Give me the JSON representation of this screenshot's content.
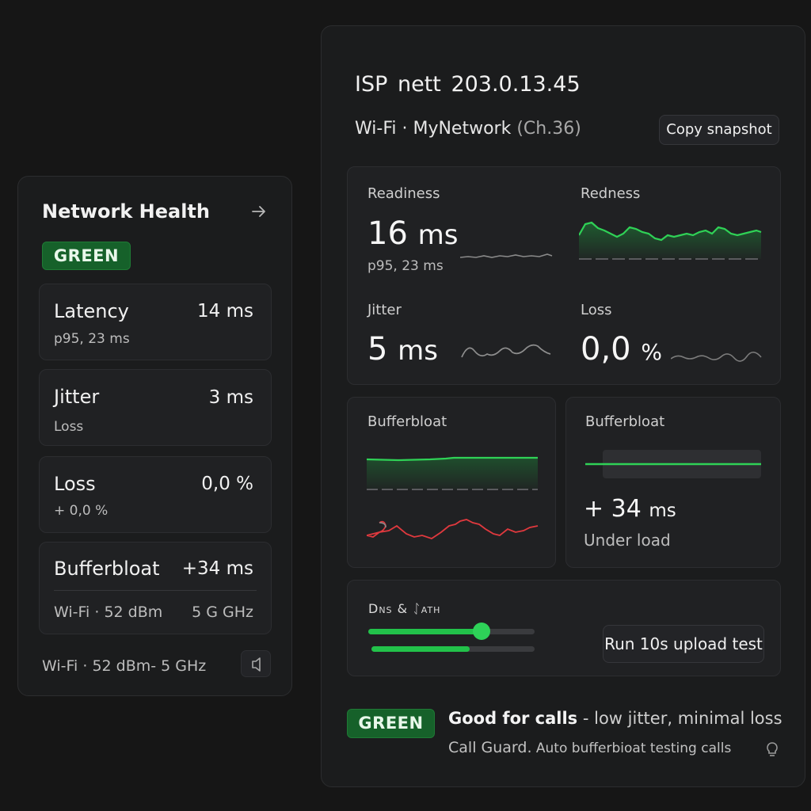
{
  "left_card": {
    "title": "Network Health",
    "arrow_icon": "arrow-right-icon",
    "status": "GREEN",
    "metrics": [
      {
        "name": "Latency",
        "value": "14 ms",
        "sub": "p95, 23 ms"
      },
      {
        "name": "Jitter",
        "value": "3 ms",
        "sub": "Loss"
      },
      {
        "name": "Loss",
        "value": "0,0 %",
        "sub": "+ 0,0 %"
      },
      {
        "name": "Bufferbloat",
        "value": "+34 ms",
        "sub": "Wi-Fi · 52 dBm",
        "sub_right": "5 G GHz"
      }
    ],
    "footer": "Wi-Fi · 52 dBm- 5 GHz",
    "footer_icon": "speaker-icon"
  },
  "right_card": {
    "isp_line": "ISP nett 203.0.13.45",
    "wifi_label": "Wi-Fi · MyNetwork",
    "wifi_channel": "(Ch.36)",
    "copy_button": "Copy snapshot",
    "stats": {
      "readiness_label": "Readiness",
      "readiness_value": "16",
      "readiness_unit": "ms",
      "readiness_sub": "p95, 23 ms",
      "redness_label": "Redness",
      "jitter_label": "Jitter",
      "jitter_value": "5",
      "jitter_unit": "ms",
      "loss_label": "Loss",
      "loss_value": "0,0",
      "loss_unit": "%"
    },
    "bufferbloat_left_label": "Bufferbloat",
    "bufferbloat_right": {
      "label": "Bufferbloat",
      "value": "+ 34",
      "unit": "ms",
      "sub": "Under load"
    },
    "dns": {
      "title": "Dns & ᛇath",
      "slider1_level": 0.68,
      "slider2_level": 0.6,
      "run_button": "Run 10s upload test"
    },
    "status": "GREEN",
    "status_bold": "Good for calls",
    "status_rest": " - low jitter, minimal loss",
    "guard_name": "Call Guard.",
    "guard_rest": " Auto bufferbioat testing calls",
    "bulb_icon": "lightbulb-icon"
  },
  "colors": {
    "accent_green": "#22c24a",
    "pill_green": "#16612a",
    "alert_red": "#e0393e"
  }
}
